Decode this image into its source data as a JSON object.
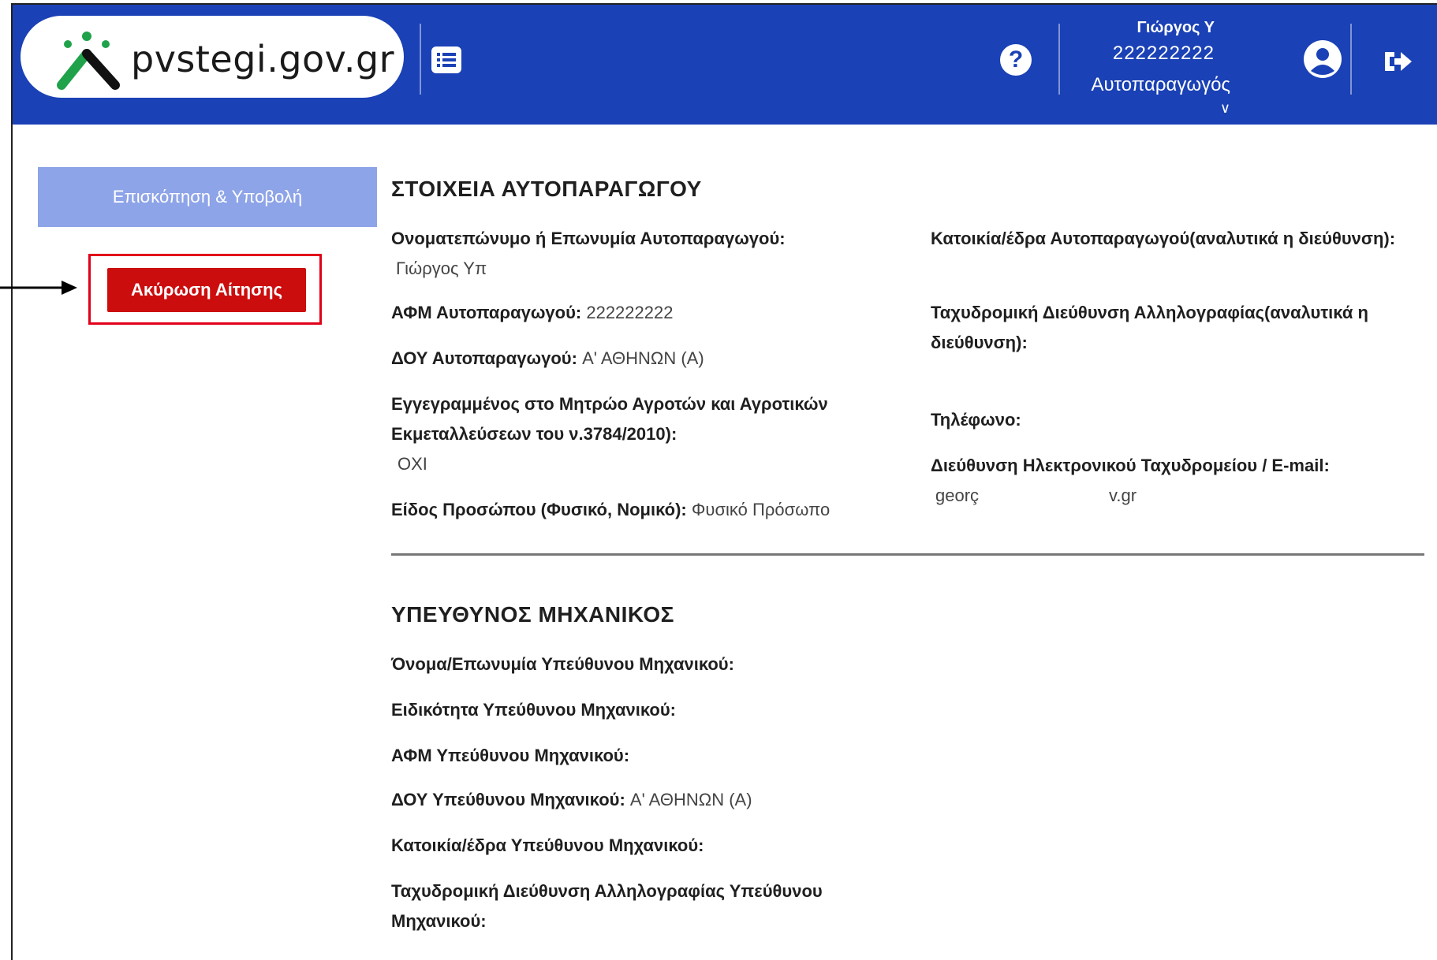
{
  "header": {
    "logo_text": "pvstegi.gov.gr",
    "user_name": "Γιώργος Υ",
    "user_afm": "222222222",
    "user_role": "Αυτοπαραγωγός",
    "brand_color": "#1a41b5"
  },
  "sidebar": {
    "overview_label": "Επισκόπηση & Υποβολή",
    "cancel_label": "Ακύρωση Αίτησης"
  },
  "producer": {
    "title": "ΣΤΟΙΧΕΙΑ ΑΥΤΟΠΑΡΑΓΩΓΟΥ",
    "name_label": "Ονοματεπώνυμο ή Επωνυμία Αυτοπαραγωγού:",
    "name_value": "Γιώργος Υπ",
    "afm_label": "ΑΦΜ Αυτοπαραγωγού:",
    "afm_value": "222222222",
    "doy_label": "ΔΟΥ Αυτοπαραγωγού:",
    "doy_value": "Α' ΑΘΗΝΩΝ (Α)",
    "registry_label_line1": "Εγγεγραμμένος στο Μητρώο Αγροτών και Αγροτικών",
    "registry_label_line2": "Εκμεταλλεύσεων του ν.3784/2010):",
    "registry_value": "ΟΧΙ",
    "person_type_label": "Είδος Προσώπου (Φυσικό, Νομικό):",
    "person_type_value": "Φυσικό Πρόσωπο",
    "residence_label": "Κατοικία/έδρα Αυτοπαραγωγού(αναλυτικά η διεύθυνση):",
    "postal_label_line1": "Ταχυδρομική Διεύθυνση Αλληλογραφίας(αναλυτικά η",
    "postal_label_line2": "διεύθυνση):",
    "phone_label": "Τηλέφωνο:",
    "email_label": "Διεύθυνση Ηλεκτρονικού Ταχυδρομείου / E-mail:",
    "email_value_start": "georç",
    "email_value_end": "v.gr"
  },
  "engineer": {
    "title": "ΥΠΕΥΘΥΝΟΣ ΜΗΧΑΝΙΚΟΣ",
    "name_label": "Όνομα/Επωνυμία Υπεύθυνου Μηχανικού:",
    "specialty_label": "Ειδικότητα Υπεύθυνου Μηχανικού:",
    "afm_label": "ΑΦΜ Υπεύθυνου Μηχανικού:",
    "doy_label": "ΔΟΥ Υπεύθυνου Μηχανικού:",
    "doy_value": "Α' ΑΘΗΝΩΝ (Α)",
    "residence_label": "Κατοικία/έδρα Υπεύθυνου Μηχανικού:",
    "postal_label_line1": "Ταχυδρομική Διεύθυνση Αλληλογραφίας Υπεύθυνου",
    "postal_label_line2": "Μηχανικού:"
  }
}
